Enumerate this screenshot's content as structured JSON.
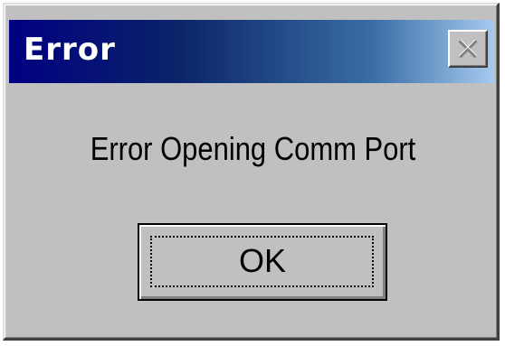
{
  "window": {
    "title": "Error",
    "close_icon": "close-icon"
  },
  "message": {
    "text": "Error Opening Comm Port"
  },
  "buttons": {
    "ok_label": "OK"
  },
  "colors": {
    "dialog_face": "#c0c0c0",
    "titlebar_start": "#000080",
    "titlebar_end": "#a6caf0",
    "title_text": "#ffffff"
  }
}
